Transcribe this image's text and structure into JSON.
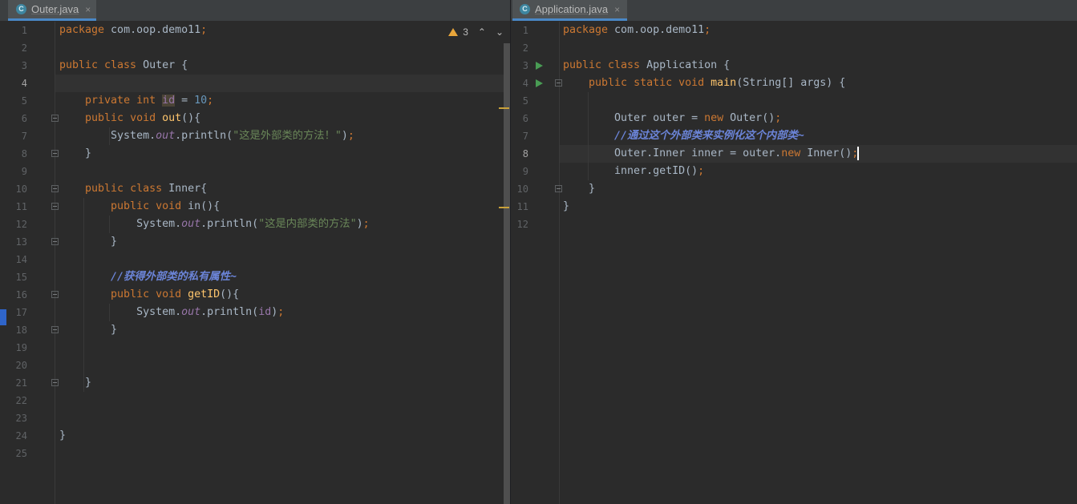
{
  "left_editor": {
    "tab": {
      "icon": "C",
      "name": "Outer.java",
      "close": "×"
    },
    "inspection": {
      "warning_count": "3",
      "up": "⌃",
      "down": "⌄"
    },
    "line_numbers": [
      "1",
      "2",
      "3",
      "4",
      "5",
      "6",
      "7",
      "8",
      "9",
      "10",
      "11",
      "12",
      "13",
      "14",
      "15",
      "16",
      "17",
      "18",
      "19",
      "20",
      "21",
      "22",
      "23",
      "24",
      "25"
    ],
    "current_line": "4"
  },
  "right_editor": {
    "tab": {
      "icon": "C",
      "name": "Application.java",
      "close": "×"
    },
    "line_numbers": [
      "1",
      "2",
      "3",
      "4",
      "5",
      "6",
      "7",
      "8",
      "9",
      "10",
      "11",
      "12"
    ],
    "current_line": "8"
  },
  "colors": {
    "background": "#2b2b2b",
    "gutter": "#313335",
    "keyword": "#cc7832",
    "string": "#6a8759",
    "number": "#6897bb",
    "method": "#ffc66d",
    "comment": "#6b84d8",
    "tab_underline": "#4a88c7"
  },
  "icons": {
    "tab_file": "java-class-icon",
    "warning": "warning-icon",
    "run": "run-gutter-icon",
    "fold": "fold-icon"
  }
}
